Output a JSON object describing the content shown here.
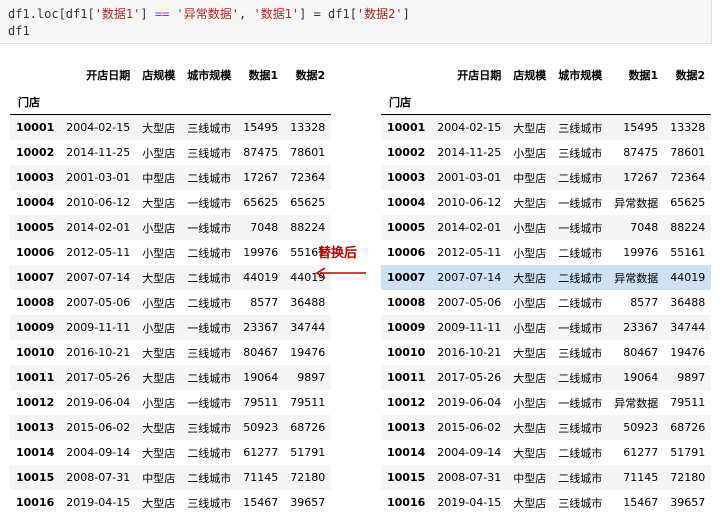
{
  "code": {
    "line1_parts": [
      "df1.loc[df1[",
      "'数据1'",
      "] ",
      "==",
      " ",
      "'异常数据'",
      ", ",
      "'数据1'",
      "] = df1[",
      "'数据2'",
      "]"
    ],
    "line2": "df1"
  },
  "arrow_label": "替换后",
  "columns": [
    "开店日期",
    "店规模",
    "城市规模",
    "数据1",
    "数据2"
  ],
  "index_name": "门店",
  "left_rows": [
    [
      "10001",
      "2004-02-15",
      "大型店",
      "三线城市",
      "15495",
      "13328"
    ],
    [
      "10002",
      "2014-11-25",
      "小型店",
      "三线城市",
      "87475",
      "78601"
    ],
    [
      "10003",
      "2001-03-01",
      "中型店",
      "二线城市",
      "17267",
      "72364"
    ],
    [
      "10004",
      "2010-06-12",
      "大型店",
      "一线城市",
      "65625",
      "65625"
    ],
    [
      "10005",
      "2014-02-01",
      "小型店",
      "一线城市",
      "7048",
      "88224"
    ],
    [
      "10006",
      "2012-05-11",
      "小型店",
      "二线城市",
      "19976",
      "55161"
    ],
    [
      "10007",
      "2007-07-14",
      "大型店",
      "二线城市",
      "44019",
      "44019"
    ],
    [
      "10008",
      "2007-05-06",
      "小型店",
      "二线城市",
      "8577",
      "36488"
    ],
    [
      "10009",
      "2009-11-11",
      "小型店",
      "一线城市",
      "23367",
      "34744"
    ],
    [
      "10010",
      "2016-10-21",
      "大型店",
      "三线城市",
      "80467",
      "19476"
    ],
    [
      "10011",
      "2017-05-26",
      "大型店",
      "二线城市",
      "19064",
      "9897"
    ],
    [
      "10012",
      "2019-06-04",
      "小型店",
      "一线城市",
      "79511",
      "79511"
    ],
    [
      "10013",
      "2015-06-02",
      "大型店",
      "三线城市",
      "50923",
      "68726"
    ],
    [
      "10014",
      "2004-09-14",
      "大型店",
      "二线城市",
      "61277",
      "51791"
    ],
    [
      "10015",
      "2008-07-31",
      "中型店",
      "二线城市",
      "71145",
      "72180"
    ],
    [
      "10016",
      "2019-04-15",
      "大型店",
      "三线城市",
      "15467",
      "39657"
    ]
  ],
  "right_rows": [
    [
      "10001",
      "2004-02-15",
      "大型店",
      "三线城市",
      "15495",
      "13328"
    ],
    [
      "10002",
      "2014-11-25",
      "小型店",
      "三线城市",
      "87475",
      "78601"
    ],
    [
      "10003",
      "2001-03-01",
      "中型店",
      "二线城市",
      "17267",
      "72364"
    ],
    [
      "10004",
      "2010-06-12",
      "大型店",
      "一线城市",
      "异常数据",
      "65625"
    ],
    [
      "10005",
      "2014-02-01",
      "小型店",
      "一线城市",
      "7048",
      "88224"
    ],
    [
      "10006",
      "2012-05-11",
      "小型店",
      "二线城市",
      "19976",
      "55161"
    ],
    [
      "10007",
      "2007-07-14",
      "大型店",
      "二线城市",
      "异常数据",
      "44019"
    ],
    [
      "10008",
      "2007-05-06",
      "小型店",
      "二线城市",
      "8577",
      "36488"
    ],
    [
      "10009",
      "2009-11-11",
      "小型店",
      "一线城市",
      "23367",
      "34744"
    ],
    [
      "10010",
      "2016-10-21",
      "大型店",
      "三线城市",
      "80467",
      "19476"
    ],
    [
      "10011",
      "2017-05-26",
      "大型店",
      "二线城市",
      "19064",
      "9897"
    ],
    [
      "10012",
      "2019-06-04",
      "小型店",
      "一线城市",
      "异常数据",
      "79511"
    ],
    [
      "10013",
      "2015-06-02",
      "大型店",
      "三线城市",
      "50923",
      "68726"
    ],
    [
      "10014",
      "2004-09-14",
      "大型店",
      "二线城市",
      "61277",
      "51791"
    ],
    [
      "10015",
      "2008-07-31",
      "中型店",
      "二线城市",
      "71145",
      "72180"
    ],
    [
      "10016",
      "2019-04-15",
      "大型店",
      "三线城市",
      "15467",
      "39657"
    ]
  ],
  "highlight_row_index": 6,
  "colors": {
    "arrow": "#c00000",
    "highlight": "#cfe2f3",
    "stripe": "#f5f5f5"
  }
}
